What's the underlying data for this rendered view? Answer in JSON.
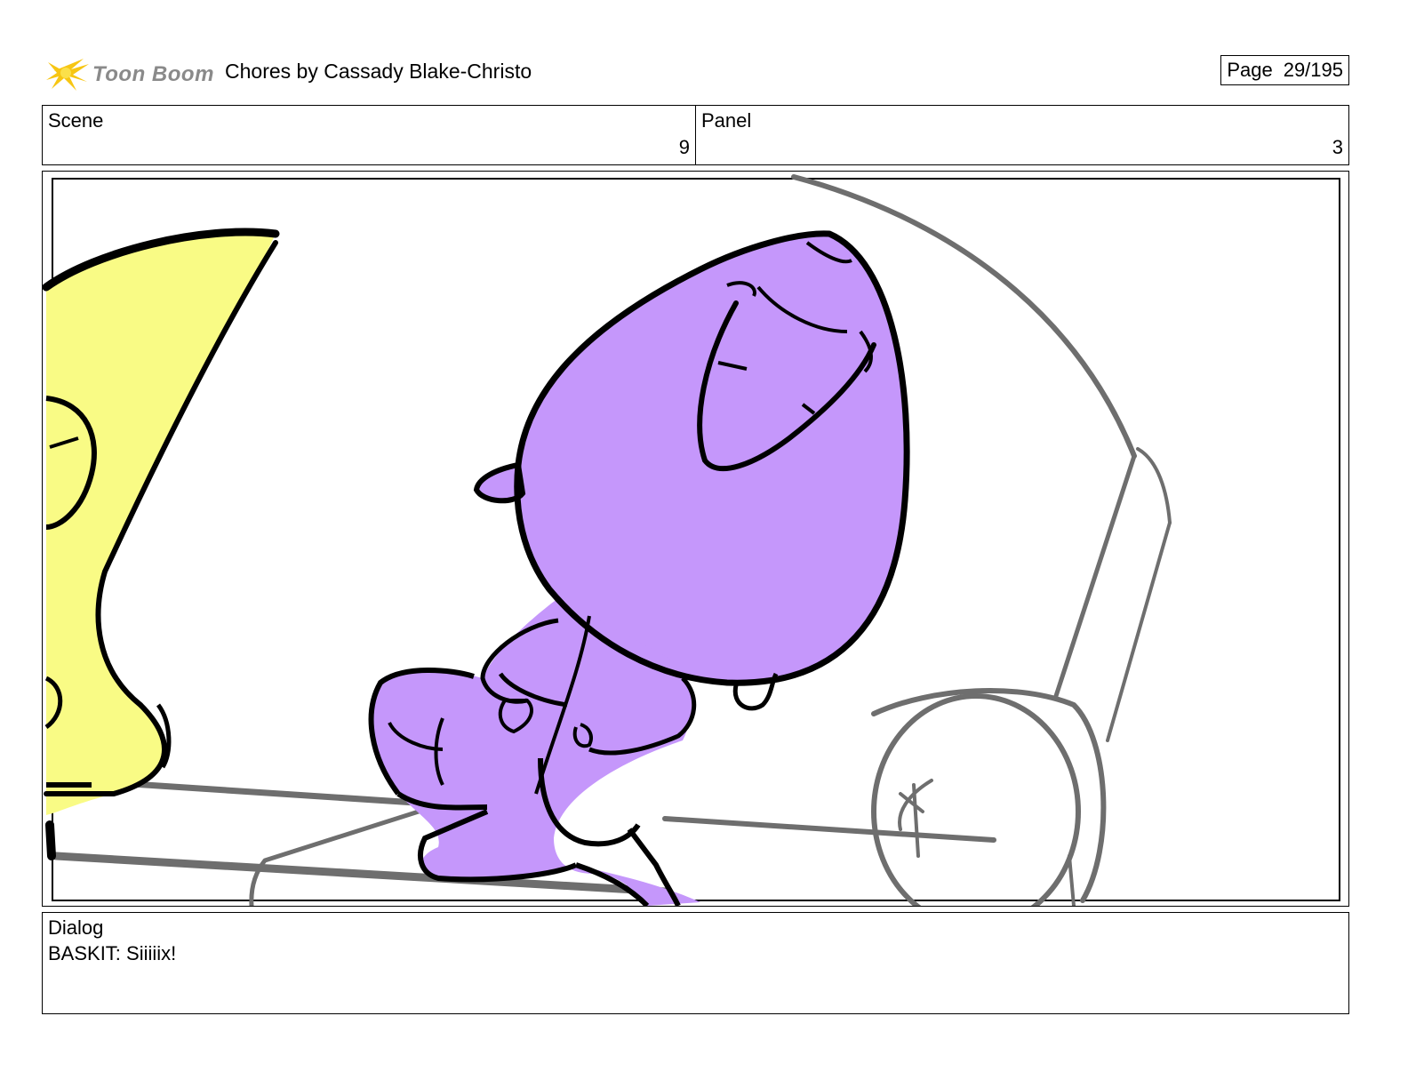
{
  "header": {
    "logo_text": "Toon Boom",
    "title": "Chores  by Cassady Blake-Christo",
    "page_label": "Page",
    "page_value": "29/195"
  },
  "scene": {
    "label": "Scene",
    "value": "9"
  },
  "panel": {
    "label": "Panel",
    "value": "3"
  },
  "dialog": {
    "label": "Dialog",
    "text": "BASKIT: Siiiiix!"
  },
  "colors": {
    "character_purple": "#c597fb",
    "character_yellow": "#f9fb85",
    "sketch_gray": "#6e6e6e",
    "logo_yellow": "#f7c613"
  }
}
